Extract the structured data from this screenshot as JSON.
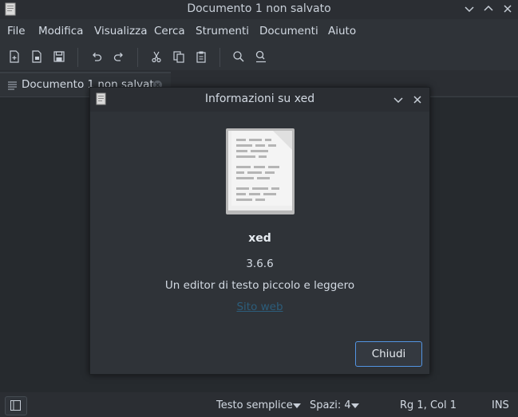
{
  "window": {
    "title": "Documento 1 non salvato"
  },
  "menubar": {
    "items": [
      "File",
      "Modifica",
      "Visualizza",
      "Cerca",
      "Strumenti",
      "Documenti",
      "Aiuto"
    ]
  },
  "toolbar": {
    "icons": [
      "new-document-icon",
      "open-document-icon",
      "save-icon",
      "undo-icon",
      "redo-icon",
      "cut-icon",
      "copy-icon",
      "paste-icon",
      "search-icon",
      "search-replace-icon"
    ]
  },
  "tab": {
    "label": "Documento 1 non salvato"
  },
  "statusbar": {
    "language": "Testo semplice",
    "spaces": "Spazi: 4",
    "position": "Rg 1, Col 1",
    "mode": "INS"
  },
  "about_dialog": {
    "title": "Informazioni su xed",
    "app_name": "xed",
    "version": "3.6.6",
    "comments": "Un editor di testo piccolo e leggero",
    "website_label": "Sito web",
    "close_label": "Chiudi"
  },
  "colors": {
    "accent": "#5294e2",
    "link": "#2c5d7b",
    "background": "#2f3338",
    "editor": "#262a2e"
  }
}
